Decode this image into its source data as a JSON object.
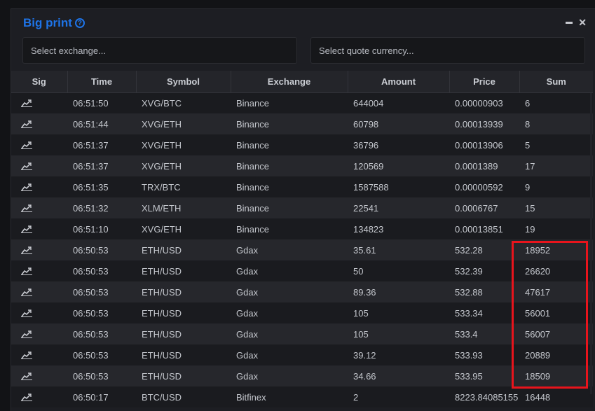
{
  "title": "Big print",
  "help_icon": "?",
  "controls": {
    "minimize": "–",
    "close": "✕"
  },
  "filters": {
    "exchange_placeholder": "Select exchange...",
    "quote_placeholder": "Select quote currency..."
  },
  "columns": [
    "Sig",
    "Time",
    "Symbol",
    "Exchange",
    "Amount",
    "Price",
    "Sum"
  ],
  "rows": [
    {
      "time": "06:51:50",
      "symbol": "XVG/BTC",
      "exchange": "Binance",
      "amount": "644004",
      "price": "0.00000903",
      "sum": "6"
    },
    {
      "time": "06:51:44",
      "symbol": "XVG/ETH",
      "exchange": "Binance",
      "amount": "60798",
      "price": "0.00013939",
      "sum": "8"
    },
    {
      "time": "06:51:37",
      "symbol": "XVG/ETH",
      "exchange": "Binance",
      "amount": "36796",
      "price": "0.00013906",
      "sum": "5"
    },
    {
      "time": "06:51:37",
      "symbol": "XVG/ETH",
      "exchange": "Binance",
      "amount": "120569",
      "price": "0.0001389",
      "sum": "17"
    },
    {
      "time": "06:51:35",
      "symbol": "TRX/BTC",
      "exchange": "Binance",
      "amount": "1587588",
      "price": "0.00000592",
      "sum": "9"
    },
    {
      "time": "06:51:32",
      "symbol": "XLM/ETH",
      "exchange": "Binance",
      "amount": "22541",
      "price": "0.0006767",
      "sum": "15"
    },
    {
      "time": "06:51:10",
      "symbol": "XVG/ETH",
      "exchange": "Binance",
      "amount": "134823",
      "price": "0.00013851",
      "sum": "19"
    },
    {
      "time": "06:50:53",
      "symbol": "ETH/USD",
      "exchange": "Gdax",
      "amount": "35.61",
      "price": "532.28",
      "sum": "18952"
    },
    {
      "time": "06:50:53",
      "symbol": "ETH/USD",
      "exchange": "Gdax",
      "amount": "50",
      "price": "532.39",
      "sum": "26620"
    },
    {
      "time": "06:50:53",
      "symbol": "ETH/USD",
      "exchange": "Gdax",
      "amount": "89.36",
      "price": "532.88",
      "sum": "47617"
    },
    {
      "time": "06:50:53",
      "symbol": "ETH/USD",
      "exchange": "Gdax",
      "amount": "105",
      "price": "533.34",
      "sum": "56001"
    },
    {
      "time": "06:50:53",
      "symbol": "ETH/USD",
      "exchange": "Gdax",
      "amount": "105",
      "price": "533.4",
      "sum": "56007"
    },
    {
      "time": "06:50:53",
      "symbol": "ETH/USD",
      "exchange": "Gdax",
      "amount": "39.12",
      "price": "533.93",
      "sum": "20889"
    },
    {
      "time": "06:50:53",
      "symbol": "ETH/USD",
      "exchange": "Gdax",
      "amount": "34.66",
      "price": "533.95",
      "sum": "18509"
    },
    {
      "time": "06:50:17",
      "symbol": "BTC/USD",
      "exchange": "Bitfinex",
      "amount": "2",
      "price": "8223.84085155",
      "sum": "16448"
    }
  ],
  "row_icon": "chart-line-icon",
  "colors": {
    "accent": "#1e74e8",
    "highlight": "#e8141c"
  }
}
